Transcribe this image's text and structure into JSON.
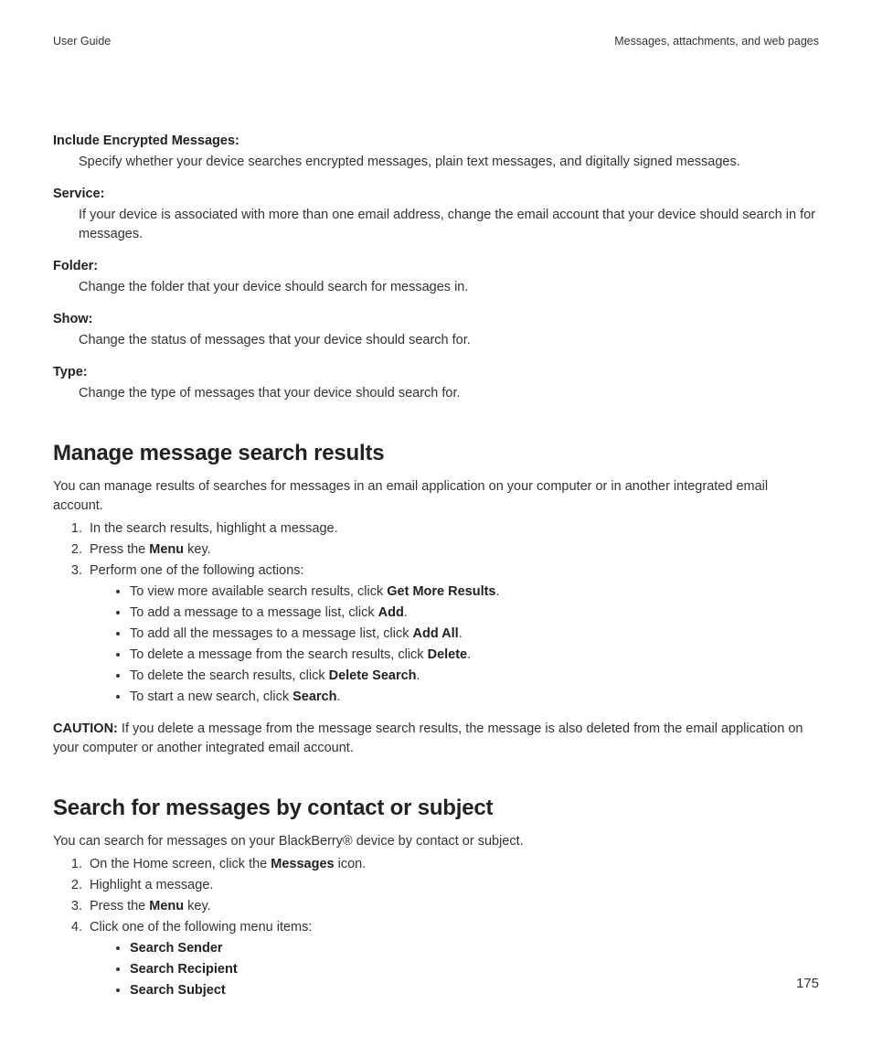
{
  "header": {
    "left": "User Guide",
    "right": "Messages, attachments, and web pages"
  },
  "dlist": [
    {
      "term": "Include Encrypted Messages:",
      "def": "Specify whether your device searches encrypted messages, plain text messages, and digitally signed messages."
    },
    {
      "term": "Service:",
      "def": "If your device is associated with more than one email address, change the email account that your device should search in for messages."
    },
    {
      "term": "Folder:",
      "def": "Change the folder that your device should search for messages in."
    },
    {
      "term": "Show:",
      "def": "Change the status of messages that your device should search for."
    },
    {
      "term": "Type:",
      "def": "Change the type of messages that your device should search for."
    }
  ],
  "sec1": {
    "heading": "Manage message search results",
    "intro": "You can manage results of searches for messages in an email application on your computer or in another integrated email account.",
    "step1": "In the search results, highlight a message.",
    "step2_a": "Press the ",
    "step2_b": "Menu",
    "step2_c": " key.",
    "step3": "Perform one of the following actions:",
    "bullets": {
      "b1_a": "To view more available search results, click ",
      "b1_b": "Get More Results",
      "b2_a": "To add a message to a message list, click ",
      "b2_b": "Add",
      "b3_a": "To add all the messages to a message list, click ",
      "b3_b": "Add All",
      "b4_a": "To delete a message from the search results, click ",
      "b4_b": "Delete",
      "b5_a": "To delete the search results, click ",
      "b5_b": "Delete Search",
      "b6_a": "To start a new search, click ",
      "b6_b": "Search"
    },
    "caution_label": "CAUTION:",
    "caution_text": "  If you delete a message from the message search results, the message is also deleted from the email application on your computer or another integrated email account."
  },
  "sec2": {
    "heading": "Search for messages by contact or subject",
    "intro": "You can search for messages on your BlackBerry® device by contact or subject.",
    "step1_a": "On the Home screen, click the ",
    "step1_b": "Messages",
    "step1_c": " icon.",
    "step2": "Highlight a message.",
    "step3_a": "Press the ",
    "step3_b": "Menu",
    "step3_c": " key.",
    "step4": "Click one of the following menu items:",
    "bullets": {
      "b1": "Search Sender",
      "b2": "Search Recipient",
      "b3": "Search Subject"
    }
  },
  "page_number": "175"
}
